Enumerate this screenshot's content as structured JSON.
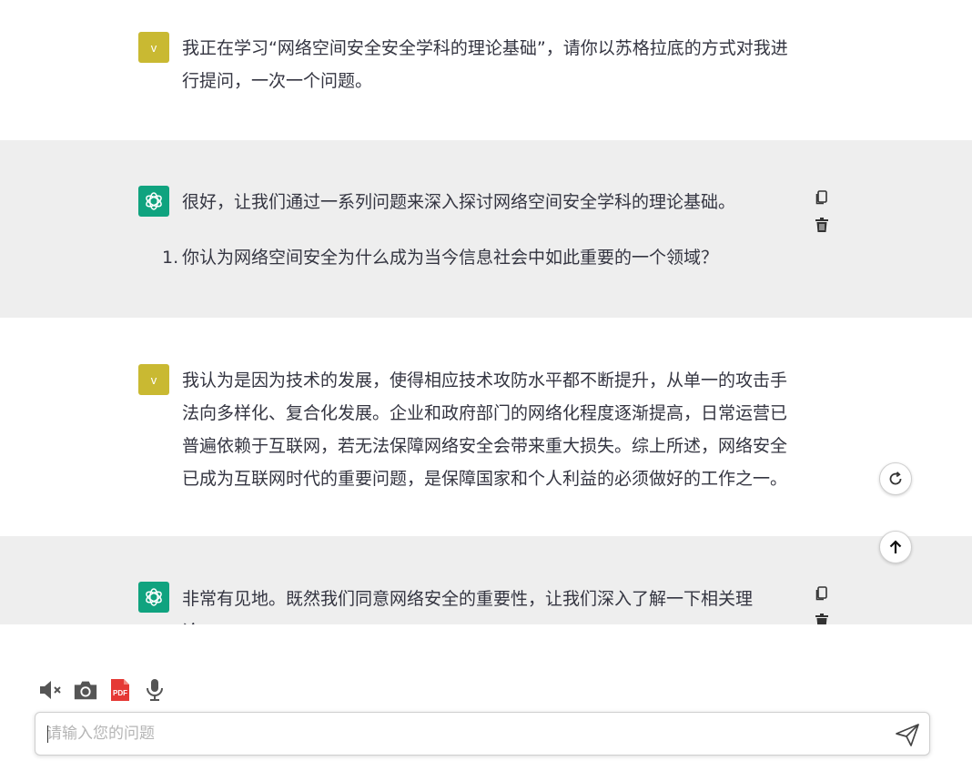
{
  "conversation": {
    "messages": [
      {
        "role": "user",
        "avatar_label": "v",
        "lines": [
          "我正在学习“网络空间安全安全学科的理论基础”，请你以苏格拉底的方式对我进",
          "行提问，一次一个问题。"
        ]
      },
      {
        "role": "assistant",
        "lines": [
          "很好，让我们通过一系列问题来深入探讨网络空间安全学科的理论基础。"
        ],
        "list_number": "1.",
        "list_item": "你认为网络空间安全为什么成为当今信息社会中如此重要的一个领域？"
      },
      {
        "role": "user",
        "avatar_label": "v",
        "lines": [
          "我认为是因为技术的发展，使得相应技术攻防水平都不断提升，从单一的攻击手",
          "法向多样化、复合化发展。企业和政府部门的网络化程度逐渐提高，日常运营已",
          "普遍依赖于互联网，若无法保障网络安全会带来重大损失。综上所述，网络安全",
          "已成为互联网时代的重要问题，是保障国家和个人利益的必须做好的工作之一。"
        ]
      },
      {
        "role": "assistant",
        "lines": [
          "非常有见地。既然我们同意网络安全的重要性，让我们深入了解一下相关理",
          "论。"
        ]
      }
    ]
  },
  "icons": {
    "copy": "copy-icon",
    "delete": "trash-icon",
    "regenerate": "refresh-icon",
    "scroll_up": "arrow-up-icon",
    "mute": "speaker-muted-icon",
    "camera": "camera-icon",
    "pdf": "pdf-icon",
    "mic": "microphone-icon",
    "send": "send-icon"
  },
  "toolbar": {
    "pdf_label": "PDF"
  },
  "input": {
    "placeholder": "请输入您的问题",
    "value": ""
  },
  "colors": {
    "user_avatar": "#c9b932",
    "assistant_avatar": "#10a37f",
    "assistant_bg": "#eeeeee",
    "pdf_red": "#e53935"
  }
}
